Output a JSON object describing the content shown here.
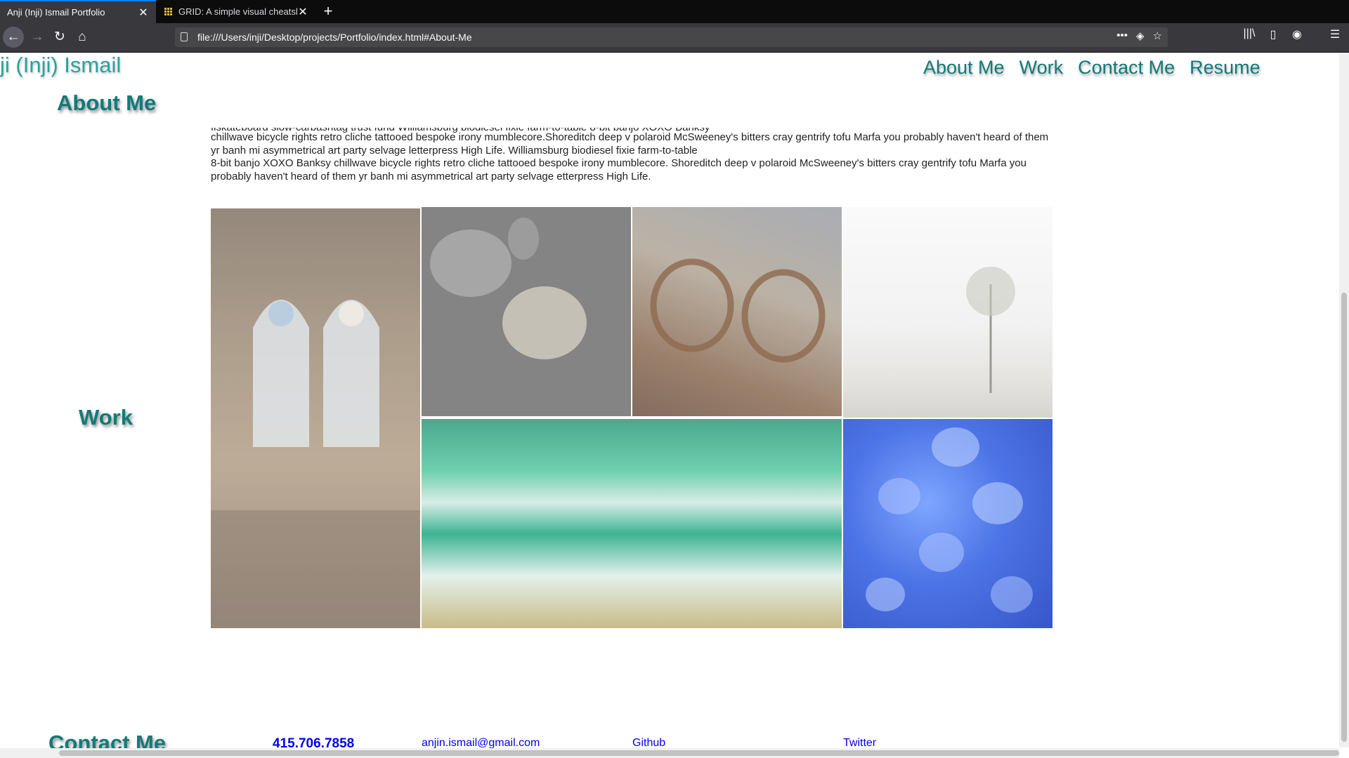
{
  "browser": {
    "tabs": [
      {
        "title": "Anji (Inji) Ismail Portfolio",
        "active": true
      },
      {
        "title": "GRID: A simple visual cheatsheet",
        "active": false
      }
    ],
    "url": "file:///Users/inji/Desktop/projects/Portfolio/index.html#About-Me",
    "icons": {
      "back": "←",
      "forward": "→",
      "reload": "↻",
      "home": "⌂",
      "page_actions": "•••",
      "pocket": "◈",
      "bookmark": "☆",
      "library": "|||\\",
      "sidebar": "▯",
      "account": "◉",
      "menu": "☰",
      "new_tab": "+",
      "close_tab": "✕"
    }
  },
  "site": {
    "title": "ji (Inji) Ismail",
    "nav": [
      "About Me",
      "Work",
      "Contact Me",
      "Resume"
    ]
  },
  "about": {
    "heading": "About Me",
    "cut_line": "fiskateboard slow-carbashtag trust fund Williamsburg biodiesel fixie farm-to-table 8-bit banjo XOXO Banksy",
    "lines": [
      "chillwave bicycle rights retro cliche tattooed bespoke irony mumblecore.Shoreditch deep v polaroid McSweeney's bitters cray gentrify tofu Marfa you probably haven't heard of them",
      "yr banh mi asymmetrical art party selvage letterpress High Life. Williamsburg biodiesel fixie farm-to-table",
      "8-bit banjo XOXO Banksy chillwave bicycle rights retro cliche tattooed bespoke irony mumblecore. Shoreditch deep v polaroid McSweeney's bitters cray gentrify tofu Marfa you",
      "probably haven't heard of them yr banh mi asymmetrical art party selvage etterpress High Life."
    ]
  },
  "work": {
    "heading": "Work",
    "images": [
      "cathedral-window",
      "jellyfish-gray",
      "eyeglasses",
      "misty-tree",
      "ocean-waves",
      "blue-jellyfish"
    ]
  },
  "contact": {
    "heading": "Contact Me",
    "phone": "415.706.7858",
    "email": "anjin.ismail@gmail.com",
    "github": "Github",
    "twitter": "Twitter"
  }
}
